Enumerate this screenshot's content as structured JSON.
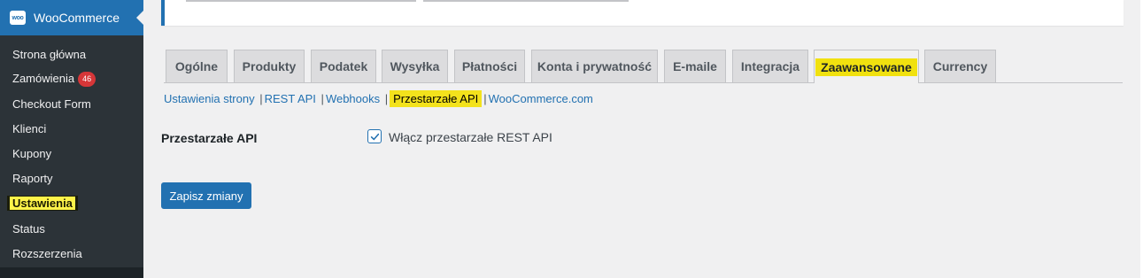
{
  "sidebar": {
    "brand": "WooCommerce",
    "brand_icon": "woo",
    "items": [
      {
        "label": "Strona główna"
      },
      {
        "label": "Zamówienia",
        "badge": "46"
      },
      {
        "label": "Checkout Form"
      },
      {
        "label": "Klienci"
      },
      {
        "label": "Kupony"
      },
      {
        "label": "Raporty"
      },
      {
        "label": "Ustawienia"
      },
      {
        "label": "Status"
      },
      {
        "label": "Rozszerzenia"
      }
    ]
  },
  "tabs": [
    {
      "label": "Ogólne"
    },
    {
      "label": "Produkty"
    },
    {
      "label": "Podatek"
    },
    {
      "label": "Wysyłka"
    },
    {
      "label": "Płatności"
    },
    {
      "label": "Konta i prywatność"
    },
    {
      "label": "E-maile"
    },
    {
      "label": "Integracja"
    },
    {
      "label": "Zaawansowane"
    },
    {
      "label": "Currency"
    }
  ],
  "subnav": [
    {
      "label": "Ustawienia strony"
    },
    {
      "label": "REST API"
    },
    {
      "label": "Webhooks"
    },
    {
      "label": "Przestarzałe API"
    },
    {
      "label": "WooCommerce.com"
    }
  ],
  "form": {
    "row_label": "Przestarzałe API",
    "checkbox_label": "Włącz przestarzałe REST API",
    "checkbox_checked": true,
    "save_label": "Zapisz zmiany"
  },
  "colors": {
    "accent": "#2271b1",
    "highlight": "#f3e21c",
    "badge": "#d63638"
  }
}
